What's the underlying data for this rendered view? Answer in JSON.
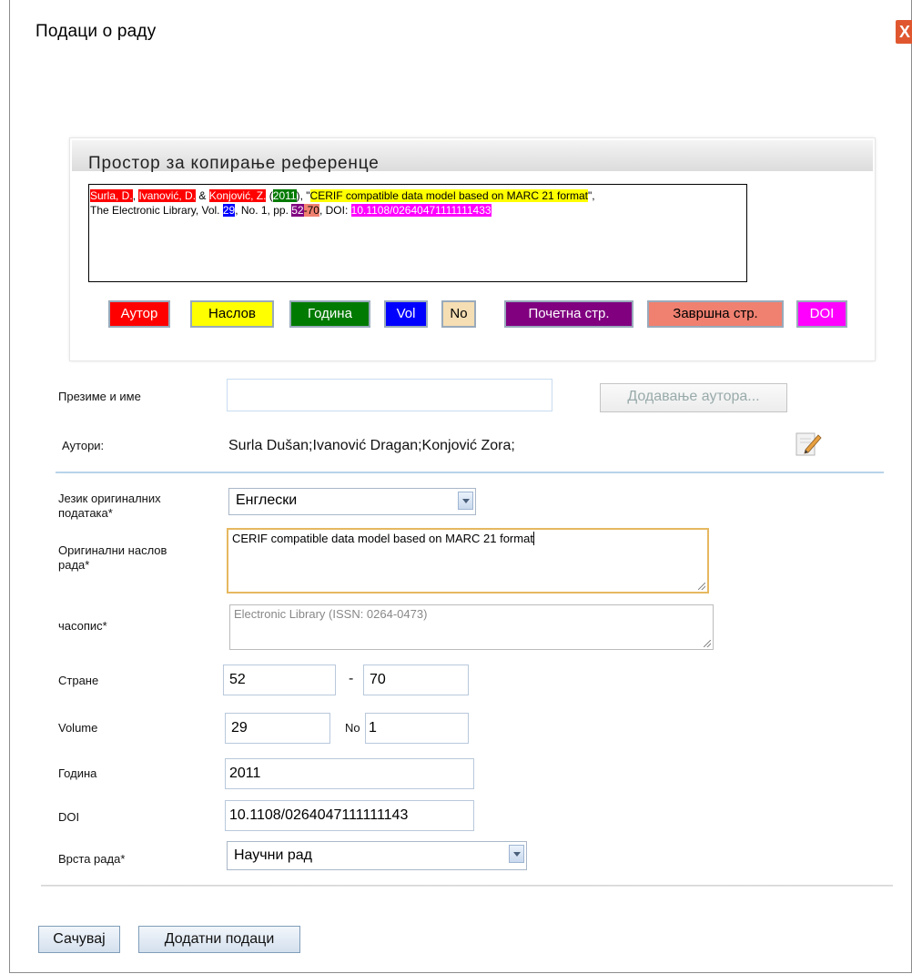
{
  "dialog": {
    "title": "Подаци о раду",
    "close_glyph": "X"
  },
  "reference": {
    "title": "Простор за копирање референце",
    "author1": "Surla, D.",
    "sep1": ", ",
    "author2": "Ivanović, D.",
    "sep2": " & ",
    "author3": "Konjović, Z.",
    "sep3": " (",
    "year": "2011",
    "sep4": "), \"",
    "title_text": "CERIF compatible data model based on MARC 21 format",
    "sep5": "\",",
    "line2_a": "The Electronic Library, Vol. ",
    "vol": "29",
    "line2_b": ", No. 1, pp. ",
    "start_page": "52",
    "dash": "-",
    "end_page": "70",
    "line2_c": ", DOI: ",
    "doi": "10.1108/02640471111111433"
  },
  "legend": {
    "author": "Аутор",
    "title": "Наслов",
    "year": "Година",
    "vol": "Vol",
    "no": "No",
    "start_page": "Почетна стр.",
    "end_page": "Завршна стр.",
    "doi": "DOI"
  },
  "form": {
    "name_label": "Презиме и име",
    "name_value": "",
    "add_author_button": "Додавање аутора...",
    "authors_label": "Аутори:",
    "authors_value": "Surla Dušan;Ivanović Dragan;Konjović Zora;",
    "language_label": "Језик оригиналних података*",
    "language_value": "Енглески",
    "orig_title_label": "Оригинални наслов рада*",
    "orig_title_value": "CERIF compatible data model based on MARC 21 format",
    "journal_label": "часопис*",
    "journal_value": "Electronic Library (ISSN: 0264-0473)",
    "pages_label": "Стране",
    "pages_from": "52",
    "pages_dash": "-",
    "pages_to": "70",
    "volume_label": "Volume",
    "volume_value": "29",
    "no_label": "No",
    "no_value": "1",
    "year_label": "Година",
    "year_value": "2011",
    "doi_label": "DOI",
    "doi_value": "10.1108/0264047111111143",
    "type_label": "Врста рада*",
    "type_value": "Научни рад"
  },
  "footer": {
    "save_button": "Сачувај",
    "extra_button": "Додатни подаци"
  },
  "colors": {
    "author": "#ff0000",
    "title": "#ffff00",
    "year": "#007a00",
    "vol": "#0000ff",
    "no": "#f5deb3",
    "start_page": "#800080",
    "end_page": "#f08070",
    "doi": "#ff00ff"
  },
  "icons": {
    "close": "close-icon",
    "edit": "edit-icon",
    "dropdown": "chevron-down-icon"
  }
}
